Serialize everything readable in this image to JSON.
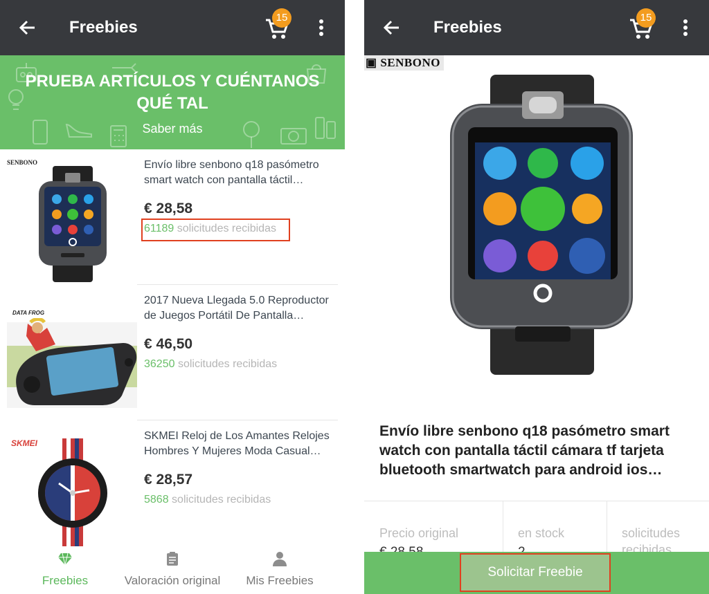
{
  "left": {
    "appbar": {
      "title": "Freebies",
      "cart_count": "15"
    },
    "banner": {
      "headline": "PRUEBA ARTÍCULOS Y CUÉNTANOS QUÉ TAL",
      "link": "Saber más"
    },
    "products": [
      {
        "name": "Envío libre senbono q18 pasómetro smart watch con pantalla táctil…",
        "price": "€ 28,58",
        "requests": "61189",
        "requests_label": "solicitudes recibidas",
        "brand": "SENBONO",
        "image": "smartwatch-image"
      },
      {
        "name": "2017 Nueva Llegada 5.0 Reproductor de Juegos Portátil De Pantalla…",
        "price": "€ 46,50",
        "requests": "36250",
        "requests_label": "solicitudes recibidas",
        "brand": "DATA FROG",
        "image": "handheld-console-image"
      },
      {
        "name": "SKMEI Reloj de Los Amantes Relojes Hombres Y Mujeres Moda Casual…",
        "price": "€ 28,57",
        "requests": "5868",
        "requests_label": "solicitudes recibidas",
        "brand": "SKMEI",
        "image": "wristwatch-image"
      }
    ],
    "bottom_nav": [
      {
        "label": "Freebies",
        "icon": "diamond-icon",
        "active": true
      },
      {
        "label": "Valoración original",
        "icon": "clipboard-icon",
        "active": false
      },
      {
        "label": "Mis Freebies",
        "icon": "person-icon",
        "active": false
      }
    ]
  },
  "right": {
    "appbar": {
      "title": "Freebies",
      "cart_count": "15"
    },
    "brand_badge": "SENBONO",
    "title": "Envío libre senbono q18 pasómetro smart watch con pantalla táctil cámara tf tarjeta bluetooth smartwatch para android ios…",
    "stats": [
      {
        "label": "Precio original",
        "value": "€ 28,58"
      },
      {
        "label": "en stock",
        "value": "2"
      },
      {
        "label": "solicitudes recibidas",
        "value": ""
      }
    ],
    "cta": "Solicitar Freebie"
  },
  "colors": {
    "appbar": "#37393d",
    "green": "#6abf69",
    "badge": "#f39c1f",
    "highlight": "#e0401f"
  }
}
